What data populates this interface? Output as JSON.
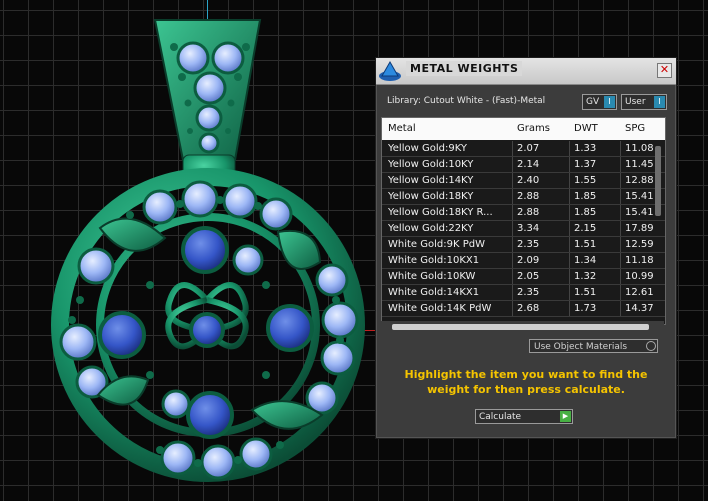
{
  "dialog": {
    "title": "METAL WEIGHTS",
    "close": "✕",
    "library_label": "Library: Cutout White - (Fast)-Metal",
    "toggle_gv": "GV",
    "toggle_user": "User",
    "toggle_knob": "I"
  },
  "table": {
    "headers": [
      "Metal",
      "Grams",
      "DWT",
      "SPG"
    ],
    "rows": [
      [
        "Yellow Gold:9KY",
        "2.07",
        "1.33",
        "11.08"
      ],
      [
        "Yellow Gold:10KY",
        "2.14",
        "1.37",
        "11.45"
      ],
      [
        "Yellow Gold:14KY",
        "2.40",
        "1.55",
        "12.88"
      ],
      [
        "Yellow Gold:18KY",
        "2.88",
        "1.85",
        "15.41"
      ],
      [
        "Yellow Gold:18KY R...",
        "2.88",
        "1.85",
        "15.41"
      ],
      [
        "Yellow Gold:22KY",
        "3.34",
        "2.15",
        "17.89"
      ],
      [
        "White Gold:9K PdW",
        "2.35",
        "1.51",
        "12.59"
      ],
      [
        "White Gold:10KX1",
        "2.09",
        "1.34",
        "11.18"
      ],
      [
        "White Gold:10KW",
        "2.05",
        "1.32",
        "10.99"
      ],
      [
        "White Gold:14KX1",
        "2.35",
        "1.51",
        "12.61"
      ],
      [
        "White Gold:14K PdW",
        "2.68",
        "1.73",
        "14.37"
      ]
    ]
  },
  "material_dropdown": "Use Object Materials",
  "hint": "Highlight the item you want to find the weight for then press calculate.",
  "calculate_label": "Calculate",
  "calculate_icon": "▶",
  "colors": {
    "metal": "#1a9e72",
    "gem": "#9db7f5",
    "center_gem": "#1d3fc6",
    "hint": "#f5c400",
    "accent_toggle": "#2a8ab0",
    "accent_go": "#47b043"
  },
  "icons": [
    "app-logo-icon",
    "close-icon",
    "chevron-right-icon",
    "dropdown-icon"
  ]
}
